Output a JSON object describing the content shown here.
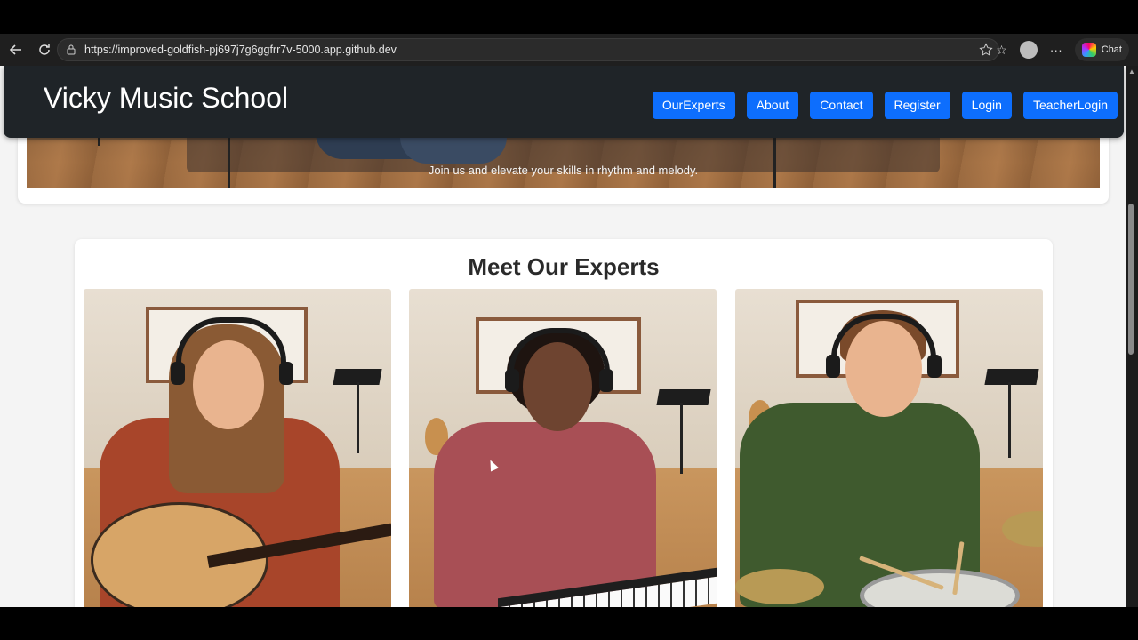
{
  "browser": {
    "url": "https://improved-goldfish-pj697j7g6ggfrr7v-5000.app.github.dev",
    "chat_label": "Chat"
  },
  "navbar": {
    "brand": "Vicky Music School",
    "links": [
      "OurExperts",
      "About",
      "Contact",
      "Register",
      "Login",
      "TeacherLogin"
    ]
  },
  "hero": {
    "subtitle": "Join us and elevate your skills in rhythm and melody."
  },
  "experts": {
    "title": "Meet Our Experts",
    "cards": [
      {
        "name": "expert-guitarist",
        "instrument": "guitar"
      },
      {
        "name": "expert-pianist",
        "instrument": "keyboard"
      },
      {
        "name": "expert-drummer",
        "instrument": "drums"
      }
    ]
  },
  "colors": {
    "navbar_bg": "#1f2428",
    "nav_button": "#0d6efd",
    "page_bg": "#f4f4f4"
  }
}
